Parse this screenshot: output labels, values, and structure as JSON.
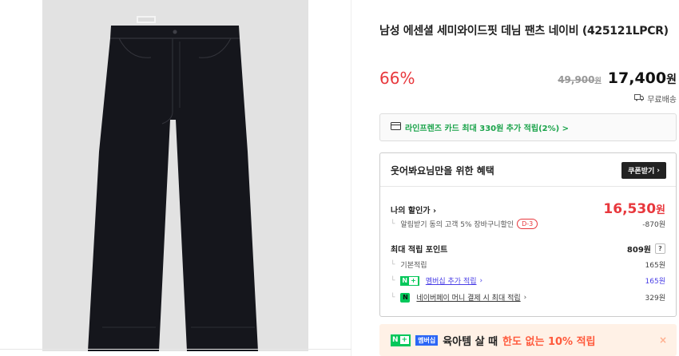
{
  "product": {
    "title": "남성 에센셜 세미와이드핏 데님 팬츠 네이비 (425121LPCR)",
    "discount_rate": "66%",
    "original_price": "49,900",
    "original_unit": "원",
    "sale_price": "17,400",
    "sale_unit": "원",
    "shipping": "무료배송"
  },
  "card_promo": {
    "text": "라인프렌즈 카드 최대 330원 추가 적립(2%) >"
  },
  "benefit": {
    "title": "웃어봐요님만을 위한 혜택",
    "coupon_button": "쿠폰받기",
    "my_price_label": "나의 할인가",
    "my_price": "16,530",
    "my_price_unit": "원",
    "coupon_desc": "알림받기 동의 고객 5% 장바구니할인",
    "coupon_badge": "D-3",
    "coupon_amount": "-870원",
    "points_label": "최대 적립 포인트",
    "points_total": "809원",
    "points_help": "?",
    "base_label": "기본적립",
    "base_value": "165원",
    "membership_badge": "N",
    "membership_label": "멤버십 추가 적립",
    "membership_value": "165원",
    "npay_label": "네이버페이 머니 결제 시 최대 적립",
    "npay_value": "329원"
  },
  "banner": {
    "badge_n": "N",
    "badge_membership": "멤버십",
    "text_black": "육아템 살 때",
    "text_red": "한도 없는 10% 적립"
  },
  "colors": {
    "accent_red": "#e8383d",
    "naver_green": "#03c75a",
    "membership_blue": "#4a3fe6"
  }
}
